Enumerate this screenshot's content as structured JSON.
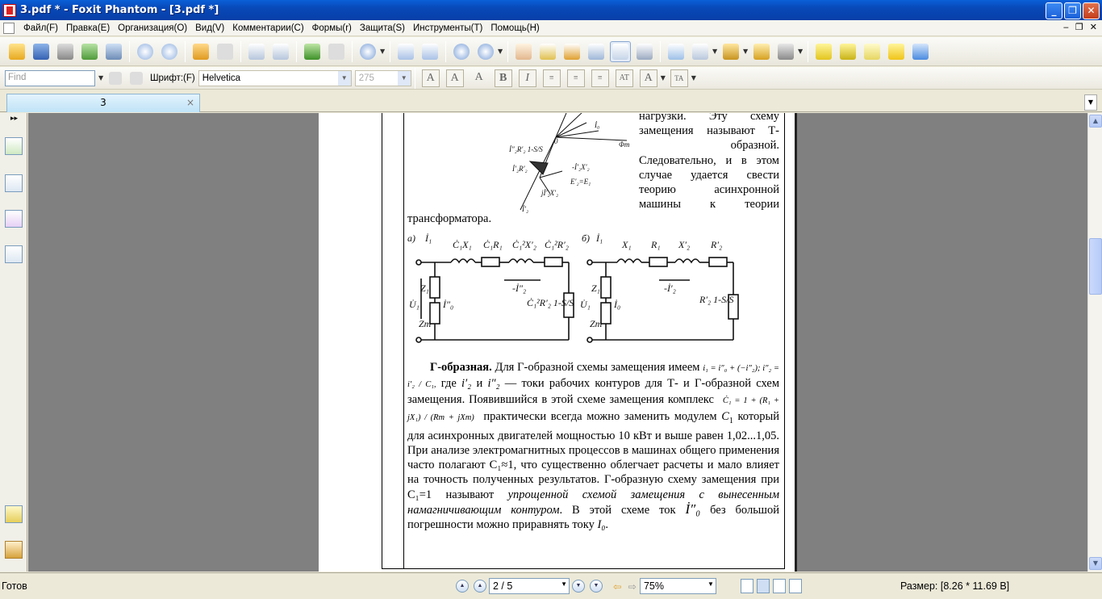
{
  "window": {
    "title": "3.pdf * - Foxit Phantom - [3.pdf *]"
  },
  "menu": [
    "Файл(F)",
    "Правка(E)",
    "Организация(O)",
    "Вид(V)",
    "Комментарии(C)",
    "Формы(r)",
    "Защита(S)",
    "Инструменты(T)",
    "Помощь(H)"
  ],
  "format_bar": {
    "find_placeholder": "Find",
    "font_label": "Шрифт:(F)",
    "font_value": "Helvetica",
    "size_value": "275"
  },
  "tab": {
    "label": "3"
  },
  "document": {
    "intro_lines": [
      "нагрузки. Эту схему",
      "замещения называют Т-",
      "образной.",
      "Следовательно, и в этом",
      "случае удается свести",
      "теорию асинхронной",
      "машины к теории"
    ],
    "intro_tail": "трансформатора.",
    "para_heading": "Г-образная.",
    "para_1": "Для Г-образной схемы замещения имеем",
    "formula_1": "i₁ = i″₀ + (−i″₂); i″₂ = i′₂ / C₁,",
    "para_2a": "где",
    "var_i2p": "i′₂",
    "para_2b": "и",
    "var_i2pp": "i″₂",
    "para_2c": "— токи рабочих контуров для Т- и Г-образной схем замещения. Появившийся в этой схеме замещения комплекс",
    "formula_2": "Ċ₁ = 1 + (R₁ + jX₁) / (Rm + jXm)",
    "para_3": "практически всегда можно заменить модулем",
    "var_c1": "C",
    "para_4": "который для асинхронных двигателей мощностью 10 кВт и выше равен 1,02...1,05. При анализе электромагнитных процессов в машинах общего применения часто полагают C₁≈1, что существенно облегчает расчеты и мало влияет на точность полученных результатов. Г-образную схему замещения при C₁=1 называют",
    "para_italic": "упрощенной схемой замещения с вынесенным намагничивающим контуром",
    "para_5": ". В этой схеме ток",
    "var_i0": "İ″₀",
    "para_6": "без большой погрешности можно приравнять току",
    "var_I0": "I₀",
    "para_end": ".",
    "circuit_a_label": "а)",
    "circuit_b_label": "б)"
  },
  "status": {
    "ready": "Готов",
    "page": "2 / 5",
    "zoom": "75%",
    "size": "Размер: [8.26 * 11.69 В]"
  }
}
